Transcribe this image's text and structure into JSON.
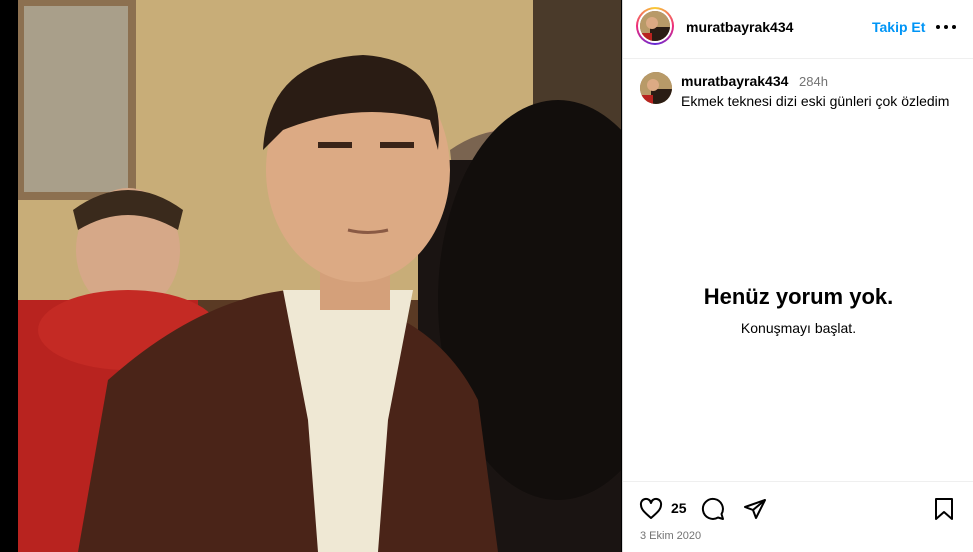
{
  "post": {
    "username": "muratbayrak434",
    "follow_label": "Takip Et",
    "caption_username": "muratbayrak434",
    "caption_time": "284h",
    "caption_text": "Ekmek teknesi dizi eski günleri çok özledim",
    "empty_title": "Henüz yorum yok.",
    "empty_subtitle": "Konuşmayı başlat.",
    "likes": "25",
    "date": "3 Ekim 2020"
  },
  "icons": {
    "more": "more-options-icon",
    "like": "heart-icon",
    "comment": "comment-icon",
    "share": "send-icon",
    "save": "bookmark-icon"
  },
  "colors": {
    "link": "#0095f6",
    "muted": "#737373",
    "border": "#dbdbdb"
  }
}
